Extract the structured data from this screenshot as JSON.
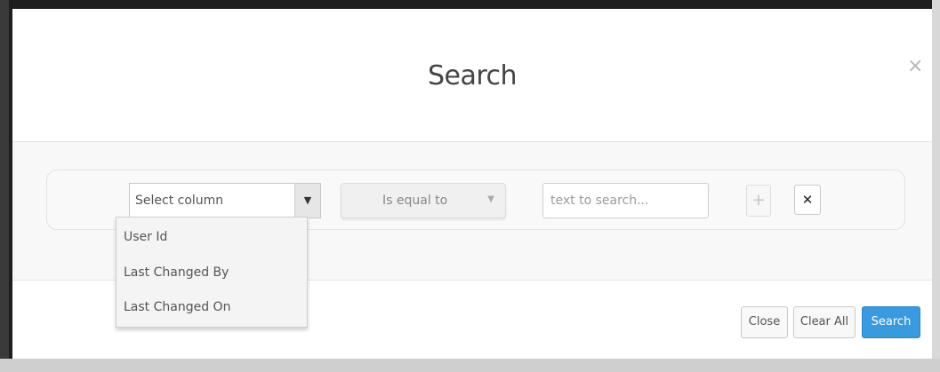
{
  "modal": {
    "title": "Search",
    "close_glyph": "×"
  },
  "filter": {
    "column_select": {
      "selected": "Select column",
      "arrow_glyph": "▼"
    },
    "operator": {
      "selected": "Is equal to",
      "arrow_glyph": "▼"
    },
    "search_input": {
      "value": "",
      "placeholder": "text to search..."
    },
    "add_glyph": "+",
    "remove_glyph": "✕"
  },
  "column_options": [
    {
      "label": "User Id"
    },
    {
      "label": "Last Changed By"
    },
    {
      "label": "Last Changed On"
    }
  ],
  "footer": {
    "close_label": "Close",
    "clear_all_label": "Clear All",
    "search_label": "Search"
  },
  "colors": {
    "primary": "#3a9ae0",
    "backdrop": "#1e1e1e"
  },
  "icons": {
    "close": "close-icon",
    "dropdown": "caret-down-icon",
    "add": "plus-icon",
    "remove": "x-icon"
  }
}
